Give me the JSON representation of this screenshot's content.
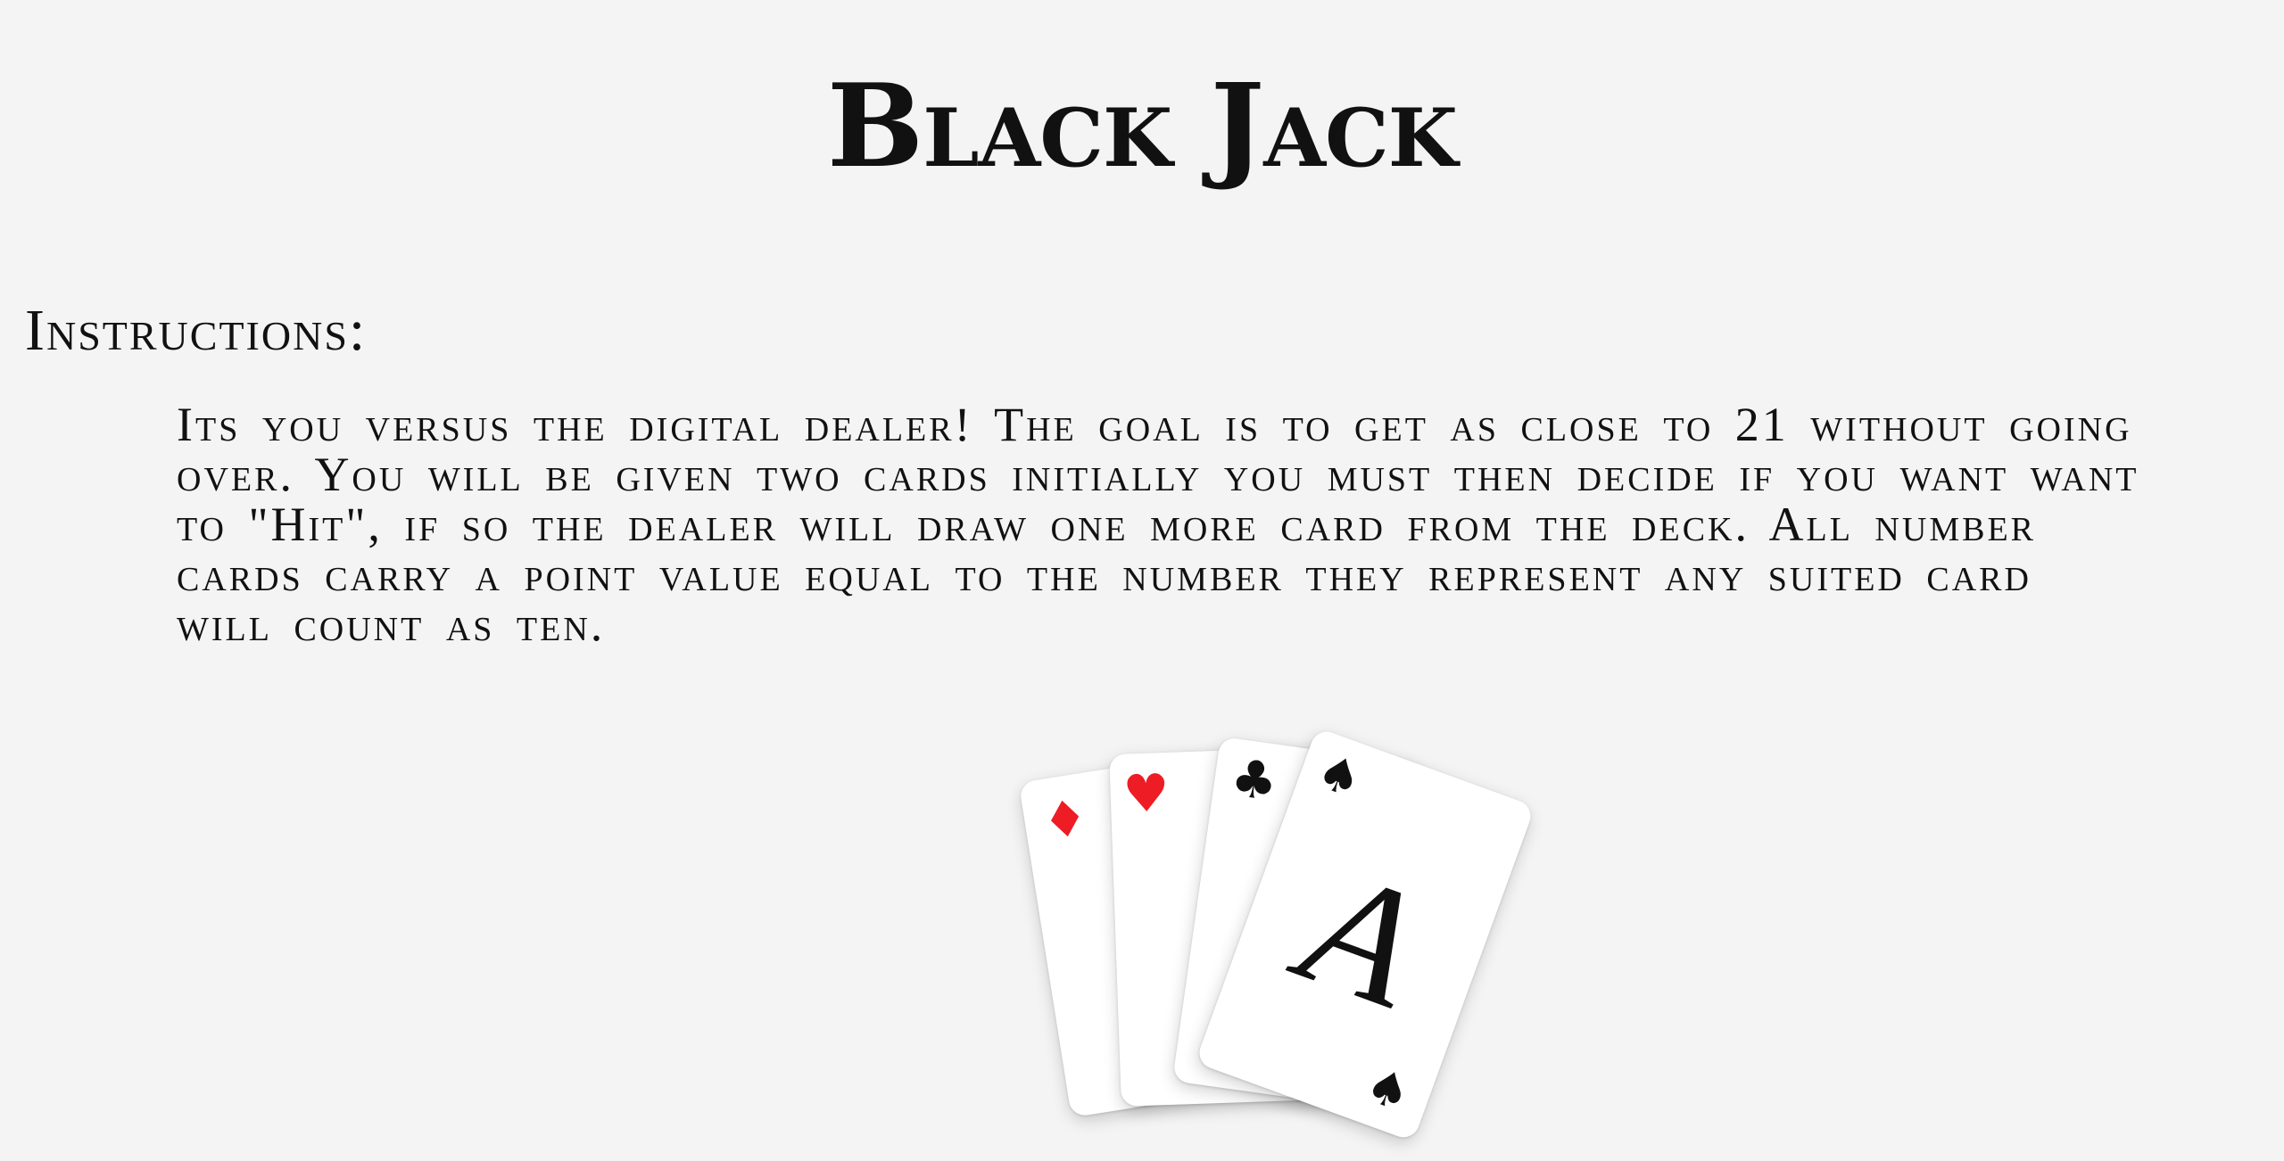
{
  "page": {
    "title": "Black Jack",
    "instructions_heading": "Instructions:",
    "instructions_text": "Its you versus the digital dealer! The goal is to get as close to 21 without going over. You will be given two cards initially you must then decide if you want want to \"Hit\", if so the dealer will draw one more card from the deck. All number cards carry a point value equal to the number they represent any suited card will count as ten."
  },
  "cards_illustration": {
    "cards": [
      {
        "suit": "diamond",
        "symbol": "♦",
        "color": "#ee1c25"
      },
      {
        "suit": "heart",
        "symbol": "♥",
        "color": "#ee1c25"
      },
      {
        "suit": "club",
        "symbol": "♣",
        "color": "#111111"
      },
      {
        "suit": "spade",
        "symbol": "♠",
        "color": "#111111",
        "rank": "A"
      }
    ]
  }
}
